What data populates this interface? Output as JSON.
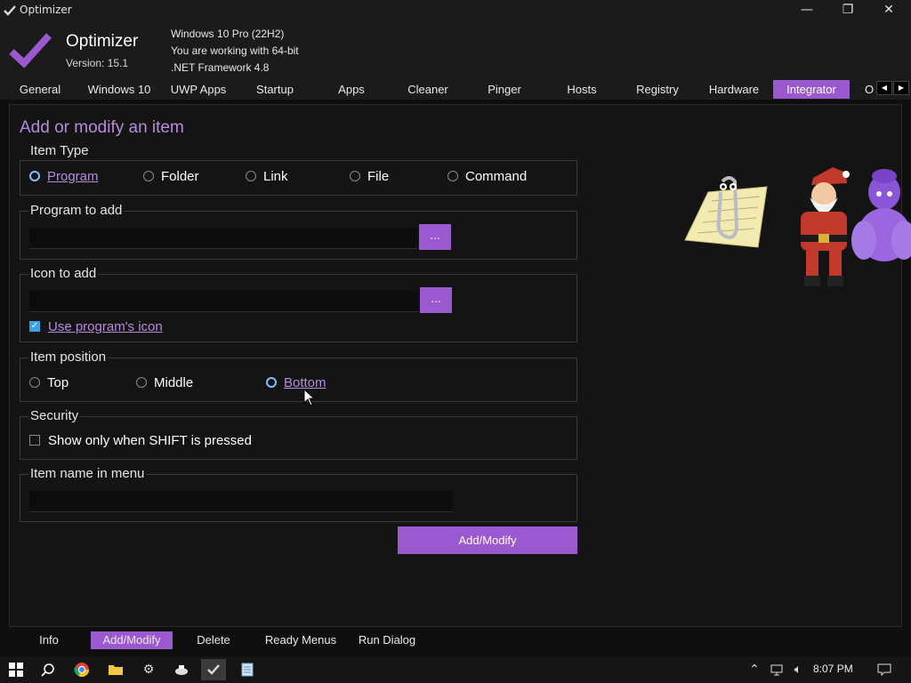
{
  "window": {
    "title": "Optimizer",
    "controls": [
      "—",
      "❐",
      "✕"
    ]
  },
  "header": {
    "app_name": "Optimizer",
    "version": "Version: 15.1",
    "sysinfo": [
      "Windows 10 Pro (22H2)",
      "You are working with 64-bit",
      ".NET Framework 4.8"
    ]
  },
  "tabs": [
    {
      "label": "General"
    },
    {
      "label": "Windows 10"
    },
    {
      "label": "UWP Apps"
    },
    {
      "label": "Startup"
    },
    {
      "label": "Apps"
    },
    {
      "label": "Cleaner"
    },
    {
      "label": "Pinger"
    },
    {
      "label": "Hosts"
    },
    {
      "label": "Registry"
    },
    {
      "label": "Hardware"
    },
    {
      "label": "Integrator"
    },
    {
      "label": "O"
    }
  ],
  "active_tab": "Integrator",
  "main": {
    "title": "Add or modify an item",
    "item_type": {
      "label": "Item Type",
      "options": [
        "Program",
        "Folder",
        "Link",
        "File",
        "Command"
      ],
      "selected": "Program"
    },
    "program": {
      "label": "Program to add",
      "value": "",
      "browse": "..."
    },
    "icon": {
      "label": "Icon to add",
      "value": "",
      "browse": "...",
      "use_program_icon": "Use program's icon",
      "use_program_icon_checked": true
    },
    "position": {
      "label": "Item position",
      "options": [
        "Top",
        "Middle",
        "Bottom"
      ],
      "selected": "Bottom"
    },
    "security": {
      "label": "Security",
      "shift_only": "Show only when SHIFT is pressed",
      "shift_only_checked": false
    },
    "name": {
      "label": "Item name in menu",
      "value": ""
    },
    "submit": "Add/Modify"
  },
  "bottom_tabs": [
    {
      "label": "Info"
    },
    {
      "label": "Add/Modify"
    },
    {
      "label": "Delete"
    },
    {
      "label": "Ready Menus"
    },
    {
      "label": "Run Dialog"
    }
  ],
  "active_bottom_tab": "Add/Modify",
  "taskbar": {
    "clock": "8:07 PM"
  },
  "colors": {
    "accent": "#9b59d0",
    "accent_text": "#b88ae0",
    "background": "#141414",
    "radio_checked": "#7ec0ff"
  }
}
